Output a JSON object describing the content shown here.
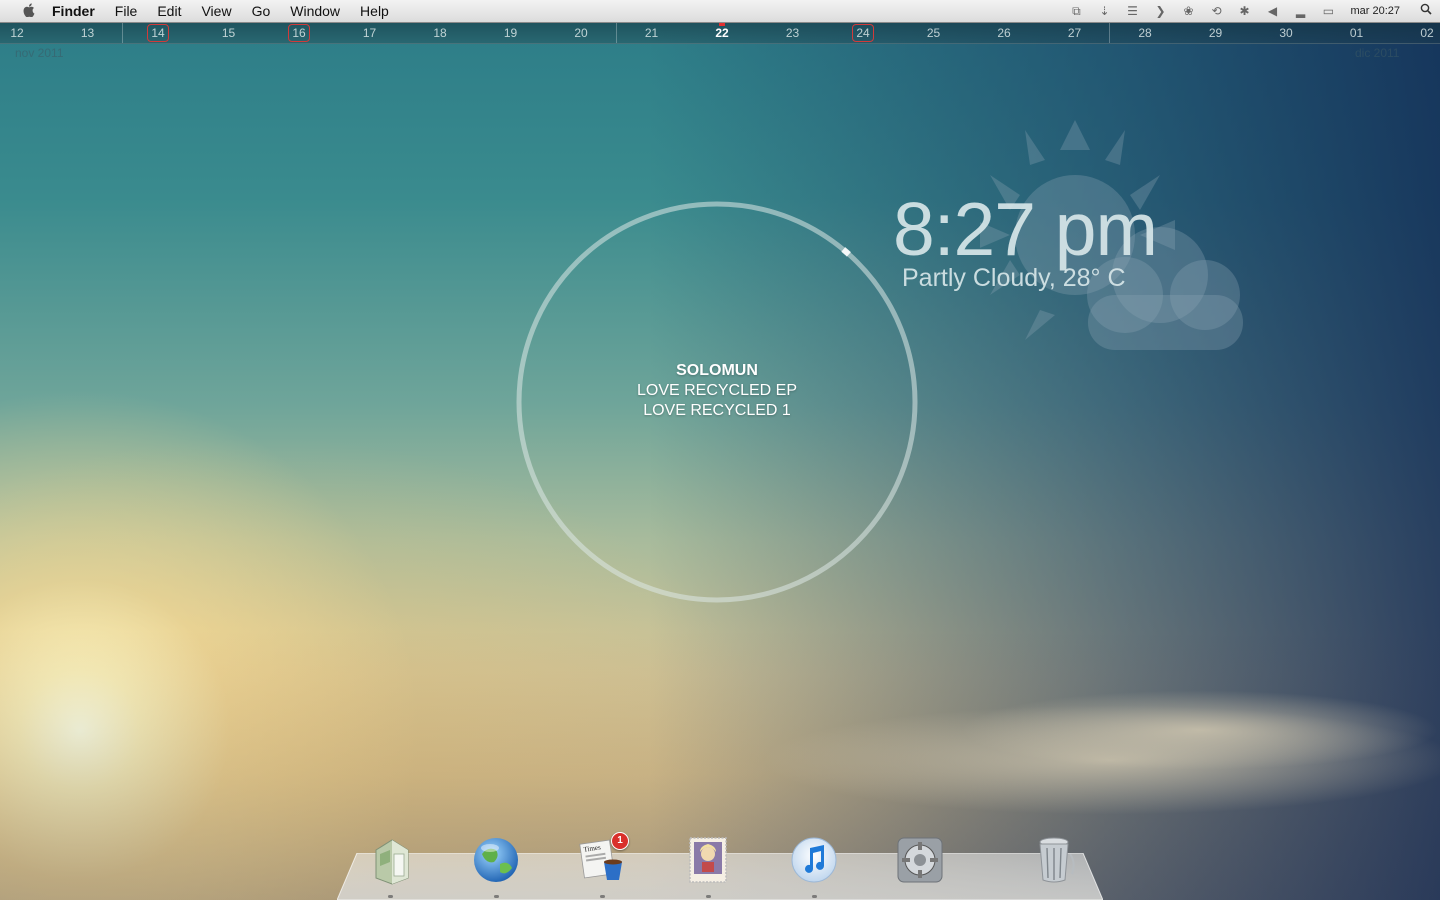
{
  "menubar": {
    "app_name": "Finder",
    "menus": [
      "File",
      "Edit",
      "View",
      "Go",
      "Window",
      "Help"
    ],
    "status_icons": [
      "window-switch-icon",
      "download-icon",
      "list-icon",
      "chevron-icon",
      "paw-icon",
      "time-machine-icon",
      "bluetooth-icon",
      "volume-icon",
      "signal-icon",
      "battery-icon"
    ],
    "clock": "mar 20:27",
    "search_icon": "magnifier-icon"
  },
  "calendar": {
    "days": [
      "12",
      "13",
      "14",
      "15",
      "16",
      "17",
      "18",
      "19",
      "20",
      "21",
      "22",
      "23",
      "24",
      "25",
      "26",
      "27",
      "28",
      "29",
      "30",
      "01",
      "02"
    ],
    "today": "22",
    "marked_days": [
      "14",
      "16",
      "24"
    ],
    "month_left": "nov 2011",
    "month_right": "dic 2011",
    "accent_color": "#d23a3a"
  },
  "weather": {
    "time": "8:27 pm",
    "condition": "Partly Cloudy, 28° C",
    "icon": "partly-cloudy-icon"
  },
  "now_playing": {
    "artist": "SOLOMUN",
    "album": "LOVE RECYCLED EP",
    "track": "LOVE RECYCLED 1",
    "progress": 0.11
  },
  "dock": {
    "items": [
      {
        "name": "Finder",
        "icon": "finder-icon"
      },
      {
        "name": "Safari",
        "icon": "globe-icon"
      },
      {
        "name": "Times",
        "icon": "times-news-icon",
        "badge": "1"
      },
      {
        "name": "Mail",
        "icon": "stamp-mail-icon"
      },
      {
        "name": "iTunes",
        "icon": "itunes-icon"
      },
      {
        "name": "System Preferences",
        "icon": "system-preferences-icon"
      },
      {
        "name": "Trash",
        "icon": "trash-icon"
      }
    ]
  },
  "colors": {
    "wallpaper_top": "#2b7b87",
    "wallpaper_bottom": "#e0c68f",
    "badge": "#d9302b"
  }
}
